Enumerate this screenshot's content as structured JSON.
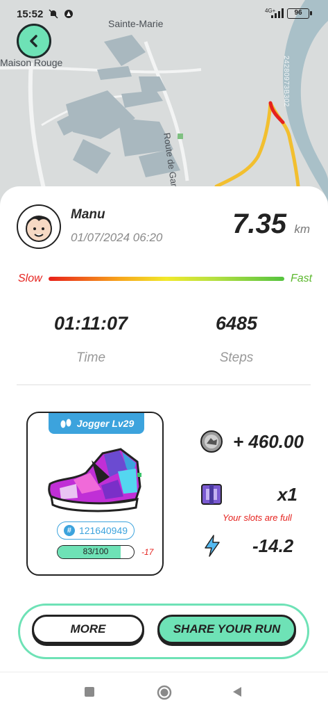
{
  "status_bar": {
    "time": "15:52",
    "network": "4G+",
    "battery": "96"
  },
  "map": {
    "labels": {
      "town": "Sainte-Marie",
      "place": "Maison Rouge",
      "road": "Route de Garche",
      "river_code": "24280973B302"
    }
  },
  "run": {
    "user_name": "Manu",
    "datetime": "01/07/2024 06:20",
    "distance": "7.35",
    "distance_unit": "km",
    "speed": {
      "slow_label": "Slow",
      "fast_label": "Fast"
    },
    "duration": "01:11:07",
    "duration_label": "Time",
    "steps": "6485",
    "steps_label": "Steps"
  },
  "sneaker": {
    "badge": "Jogger Lv29",
    "id": "121640949",
    "durability": "83/100",
    "durability_fraction": 0.83,
    "durability_loss": "-17"
  },
  "rewards": {
    "coins": "+ 460.00",
    "mystery_box": "x1",
    "slots_message": "Your slots are full",
    "energy": "-14.2"
  },
  "actions": {
    "more": "MORE",
    "share": "SHARE YOUR RUN"
  },
  "colors": {
    "accent": "#6ee2b6",
    "badge_blue": "#3ca3dd",
    "route": "#f2bf2f",
    "slow": "#e5221e",
    "fast": "#5cb82e"
  }
}
